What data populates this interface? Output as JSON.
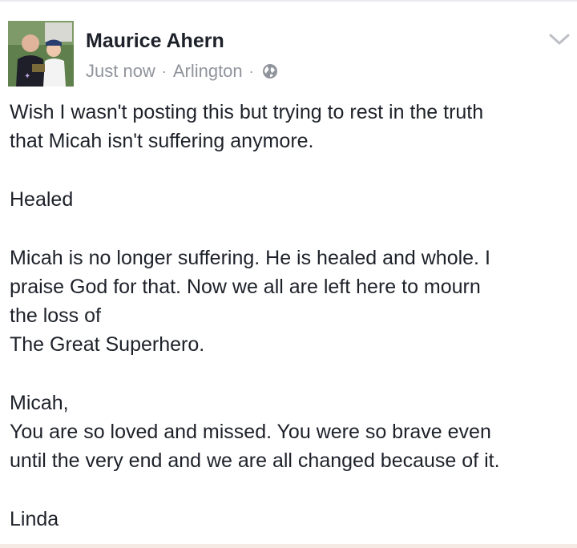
{
  "post": {
    "author": "Maurice Ahern",
    "timestamp": "Just now",
    "separator": "·",
    "location": "Arlington",
    "privacy_icon": "globe-icon",
    "menu_icon": "chevron-down-icon",
    "paragraphs": [
      "Wish I wasn't posting this but trying to rest in the truth\nthat Micah isn't suffering anymore.",
      "Healed",
      "Micah is no longer suffering. He is healed and whole. I\npraise God for that. Now we all are left here to mourn\nthe loss of\nThe Great Superhero.",
      "Micah,\nYou are so loved and missed. You were so brave even\nuntil the very end and we are all changed because of it.",
      "Linda"
    ]
  },
  "colors": {
    "name": "#1d2129",
    "meta": "#90949c",
    "body_text": "#1d2129",
    "background": "#ffffff"
  }
}
